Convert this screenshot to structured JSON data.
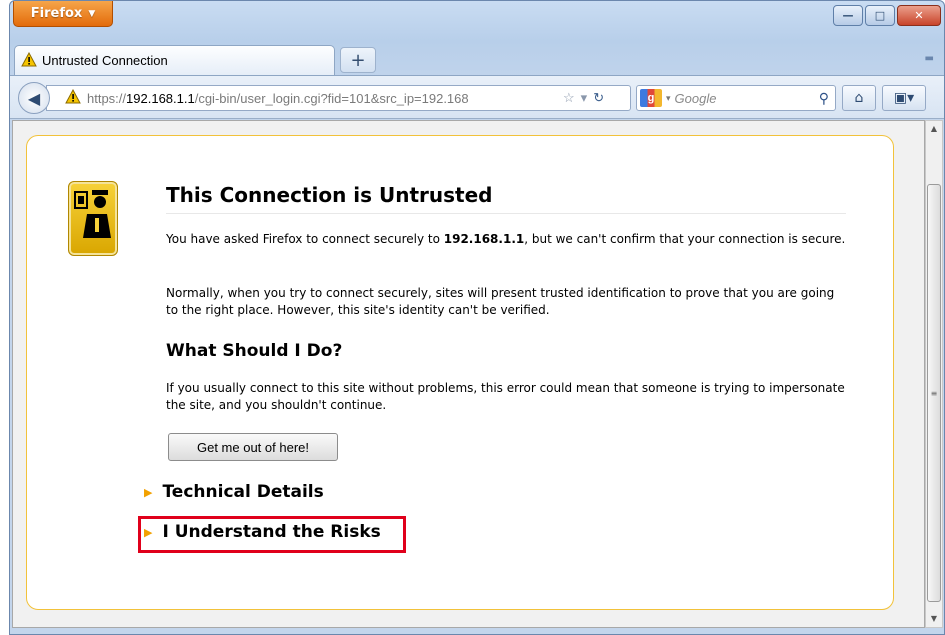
{
  "window": {
    "menu_label": "Firefox",
    "minimize_icon": "minimize-icon",
    "maximize_icon": "maximize-icon",
    "close_icon": "close-icon"
  },
  "tab": {
    "title": "Untrusted Connection",
    "icon": "warning-icon",
    "new_tab_label": "+"
  },
  "nav": {
    "url_prefix": "https://",
    "url_host": "192.168.1.1",
    "url_path": "/cgi-bin/user_login.cgi?fid=101&src_ip=192.168",
    "search_placeholder": "Google"
  },
  "page": {
    "title": "This Connection is Untrusted",
    "p1_before": "You have asked Firefox to connect securely to ",
    "p1_host": "192.168.1.1",
    "p1_after": ", but we can't confirm that your connection is secure.",
    "p2": "Normally, when you try to connect securely, sites will present trusted identification to prove that you are going to the right place. However, this site's identity can't be verified.",
    "subheading": "What Should I Do?",
    "p3": "If you usually connect to this site without problems, this error could mean that someone is trying to impersonate the site, and you shouldn't continue.",
    "button_label": "Get me out of here!",
    "technical_details": "Technical Details",
    "understand_risks": "I Understand the Risks"
  },
  "colors": {
    "box_border": "#f2c23a",
    "highlight": "#e0001b",
    "triangle": "#f2a100",
    "firefox_orange": "#e36b0a"
  }
}
